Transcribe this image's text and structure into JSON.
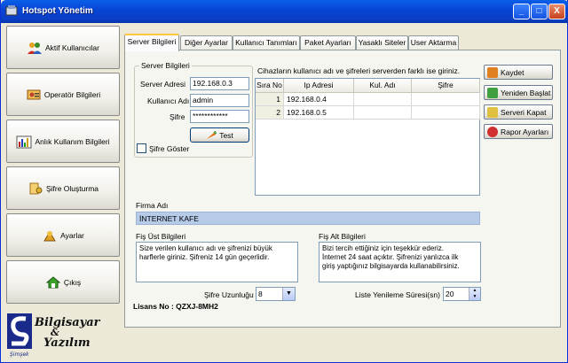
{
  "window": {
    "title": "Hotspot Yönetim",
    "min": "_",
    "max": "□",
    "close": "X"
  },
  "nav": [
    {
      "label": "Aktif Kullanıcılar",
      "icon": "users-icon"
    },
    {
      "label": "Operatör Bilgileri",
      "icon": "operator-icon"
    },
    {
      "label": "Anlık Kullanım Bilgileri",
      "icon": "bar-chart-icon"
    },
    {
      "label": "Şifre Oluşturma",
      "icon": "key-icon"
    },
    {
      "label": "Ayarlar",
      "icon": "settings-icon"
    },
    {
      "label": "Çıkış",
      "icon": "exit-icon"
    }
  ],
  "logo": {
    "line1": "Bilgisayar",
    "amp": "&",
    "line2": "Yazılım",
    "mark": "Şimşek"
  },
  "tabs": [
    "Server Bilgileri",
    "Diğer Ayarlar",
    "Kullanıcı Tanımları",
    "Paket Ayarları",
    "Yasaklı Siteler",
    "User Aktarma"
  ],
  "server": {
    "group_label": "Server Bilgileri",
    "address_label": "Server Adresi",
    "address_value": "192.168.0.3",
    "user_label": "Kullanıcı Adı",
    "user_value": "admin",
    "pass_label": "Şifre",
    "pass_value": "************",
    "test_label": "Test",
    "show_pass_label": "Şifre Göster"
  },
  "grid": {
    "caption": "Cihazların kullanıcı adı ve şifreleri serverden farklı ise giriniz.",
    "headers": [
      "Sıra No",
      "Ip Adresi",
      "Kul. Adı",
      "Şifre"
    ],
    "rows": [
      {
        "no": "1",
        "ip": "192.168.0.4",
        "user": "",
        "pass": ""
      },
      {
        "no": "2",
        "ip": "192.168.0.5",
        "user": "",
        "pass": ""
      }
    ]
  },
  "actions": {
    "save": "Kaydet",
    "restart": "Yeniden Başlat",
    "shutdown": "Serveri Kapat",
    "report": "Rapor Ayarları"
  },
  "firma": {
    "label": "Firma Adı",
    "value": "İNTERNET KAFE"
  },
  "fis_ust": {
    "label": "Fiş Üst Bilgileri",
    "text": "Size verilen kullanıcı adı ve şifrenizi büyük\nharflerle giriniz. Şifreniz 14 gün geçerlidir."
  },
  "fis_alt": {
    "label": "Fiş Alt Bilgileri",
    "text": "Bizi tercih ettiğiniz için teşekkür ederiz.\nİnternet 24 saat açıktır. Şifrenizi yanlızca ilk\ngiriş yaptığınız bilgisayarda kullanabilirsiniz."
  },
  "sifre_uzunlugu": {
    "label": "Şifre Uzunluğu",
    "value": "8"
  },
  "liste_yenileme": {
    "label": "Liste Yenileme Süresi(sn)",
    "value": "20"
  },
  "license": {
    "text": "Lisans No : QZXJ-8MH2"
  },
  "colors": {
    "titlebar": "#0846d6",
    "accent_tab": "#ffc83c",
    "firma_bg": "#b6cbe8"
  }
}
